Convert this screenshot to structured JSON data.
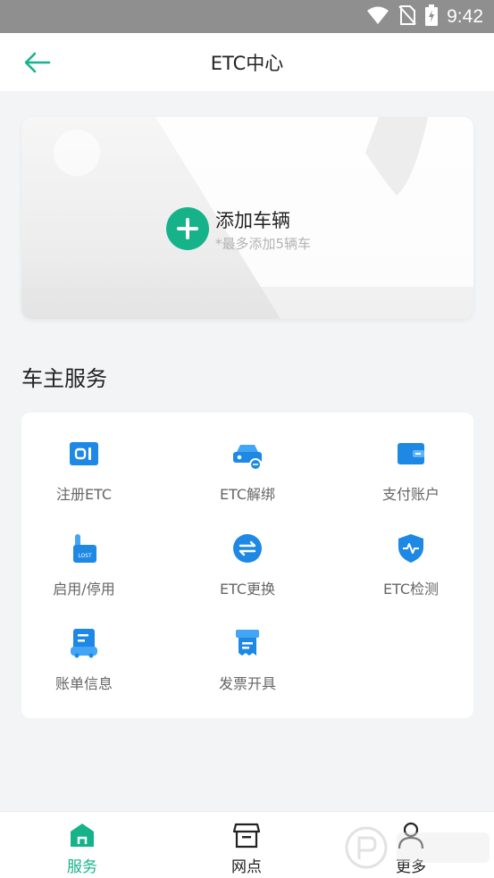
{
  "status_bar": {
    "time": "9:42",
    "icons": [
      "wifi-icon",
      "no-sim-icon",
      "battery-charging-icon"
    ]
  },
  "header": {
    "title": "ETC中心",
    "back_icon": "arrow-left-icon"
  },
  "vehicle_card": {
    "add_title": "添加车辆",
    "add_note": "*最多添加5辆车",
    "add_icon": "plus-icon"
  },
  "section": {
    "title": "车主服务"
  },
  "services": [
    {
      "label": "注册ETC",
      "icon": "etc-card-icon"
    },
    {
      "label": "ETC解绑",
      "icon": "car-unbind-icon"
    },
    {
      "label": "支付账户",
      "icon": "wallet-icon"
    },
    {
      "label": "启用/停用",
      "icon": "hand-lost-icon"
    },
    {
      "label": "ETC更换",
      "icon": "exchange-icon"
    },
    {
      "label": "ETC检测",
      "icon": "shield-check-icon"
    },
    {
      "label": "账单信息",
      "icon": "bill-icon"
    },
    {
      "label": "发票开具",
      "icon": "invoice-icon"
    }
  ],
  "tabbar": [
    {
      "label": "服务",
      "icon": "home-icon",
      "active": true
    },
    {
      "label": "网点",
      "icon": "store-icon",
      "active": false
    },
    {
      "label": "更多",
      "icon": "person-icon",
      "active": false
    }
  ],
  "colors": {
    "accent": "#16b38b",
    "service_blue": "#1e88e5"
  }
}
